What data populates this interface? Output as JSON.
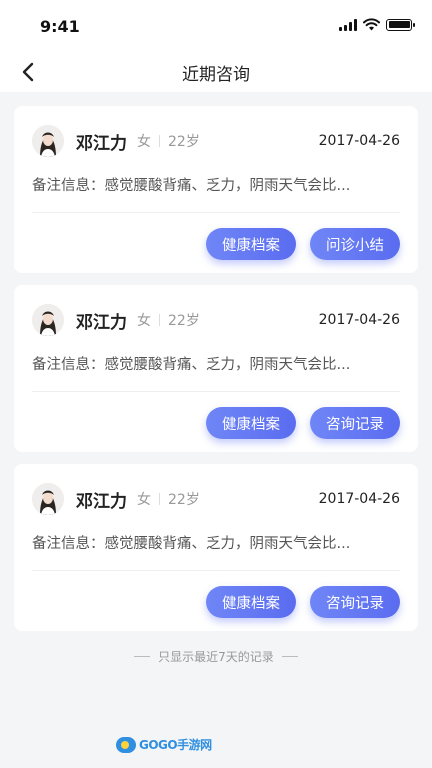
{
  "status_bar": {
    "time": "9:41"
  },
  "header": {
    "title": "近期咨询"
  },
  "records": [
    {
      "name": "邓江力",
      "gender": "女",
      "age": "22岁",
      "date": "2017-04-26",
      "remark": "备注信息：感觉腰酸背痛、乏力，阴雨天气会比...",
      "buttons": [
        "健康档案",
        "问诊小结"
      ]
    },
    {
      "name": "邓江力",
      "gender": "女",
      "age": "22岁",
      "date": "2017-04-26",
      "remark": "备注信息：感觉腰酸背痛、乏力，阴雨天气会比...",
      "buttons": [
        "健康档案",
        "咨询记录"
      ]
    },
    {
      "name": "邓江力",
      "gender": "女",
      "age": "22岁",
      "date": "2017-04-26",
      "remark": "备注信息：感觉腰酸背痛、乏力，阴雨天气会比...",
      "buttons": [
        "健康档案",
        "咨询记录"
      ]
    }
  ],
  "footer": {
    "note": "只显示最近7天的记录"
  },
  "watermark": {
    "text": "GOGO手游网"
  },
  "colors": {
    "accent": "#5a6cf0",
    "background": "#f4f5f7"
  }
}
